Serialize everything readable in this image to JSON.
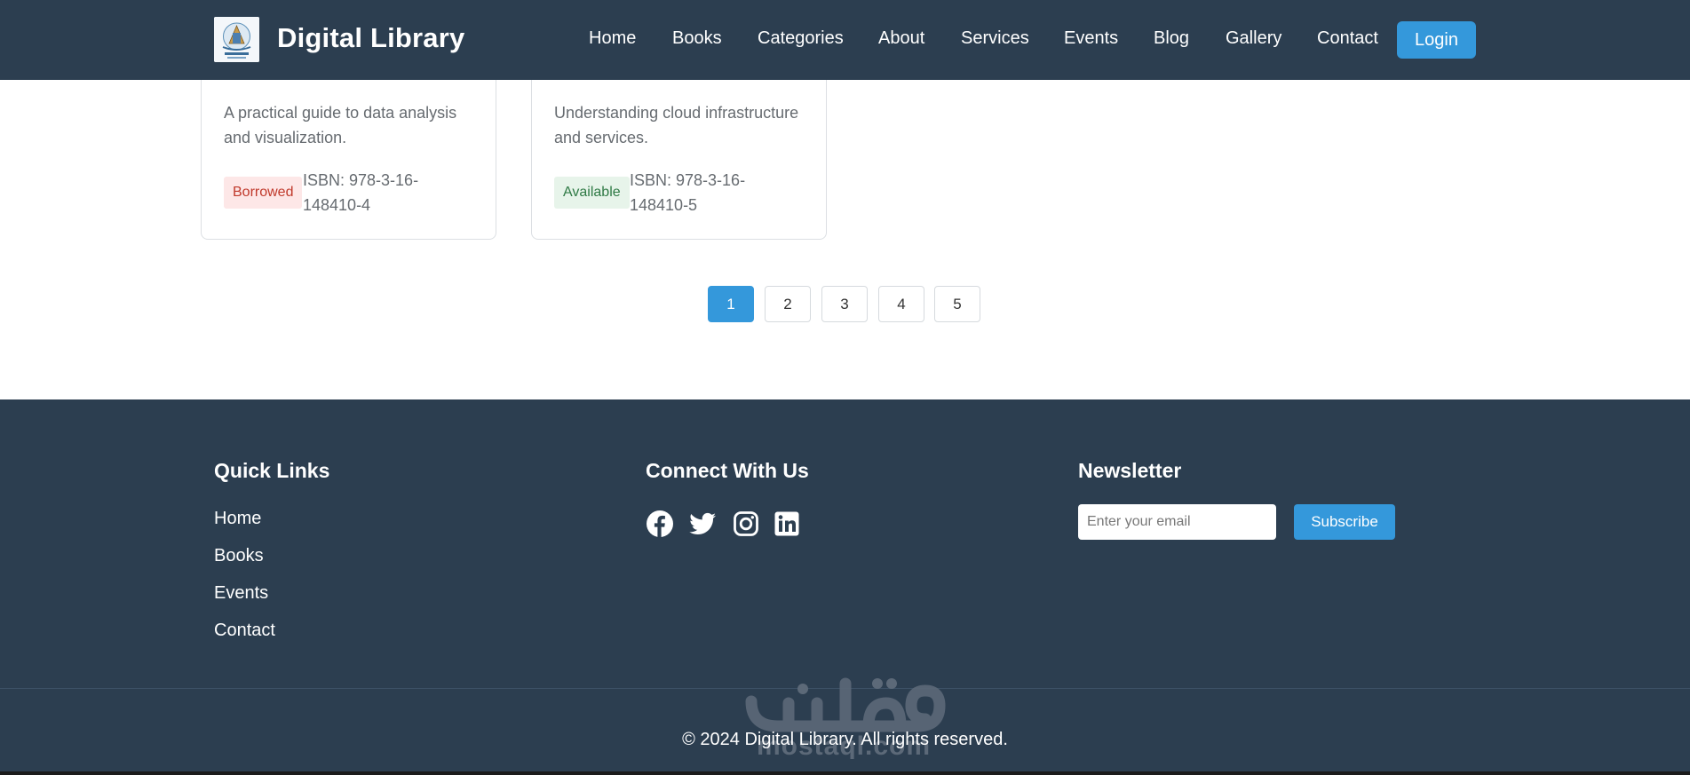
{
  "header": {
    "brand": "Digital Library",
    "nav": [
      "Home",
      "Books",
      "Categories",
      "About",
      "Services",
      "Events",
      "Blog",
      "Gallery",
      "Contact"
    ],
    "login_label": "Login"
  },
  "books": [
    {
      "description": "A practical guide to data analysis and visualization.",
      "status": "Borrowed",
      "isbn": "ISBN: 978-3-16-148410-4"
    },
    {
      "description": "Understanding cloud infrastructure and services.",
      "status": "Available",
      "isbn": "ISBN: 978-3-16-148410-5"
    }
  ],
  "pagination": {
    "pages": [
      "1",
      "2",
      "3",
      "4",
      "5"
    ],
    "current": "1"
  },
  "footer": {
    "quick_links_title": "Quick Links",
    "quick_links": [
      "Home",
      "Books",
      "Events",
      "Contact"
    ],
    "connect_title": "Connect With Us",
    "social_icons": [
      "facebook-icon",
      "twitter-icon",
      "instagram-icon",
      "linkedin-icon"
    ],
    "newsletter_title": "Newsletter",
    "email_placeholder": "Enter your email",
    "subscribe_label": "Subscribe",
    "copyright": "© 2024 Digital Library. All rights reserved.",
    "watermark": "مستقل mostaql.com"
  },
  "colors": {
    "navy": "#2c3e50",
    "accent": "#3498db",
    "borrowed_bg": "#fde7e7",
    "borrowed_text": "#c0392b",
    "available_bg": "#e7f4ea",
    "available_text": "#2f7a45"
  }
}
